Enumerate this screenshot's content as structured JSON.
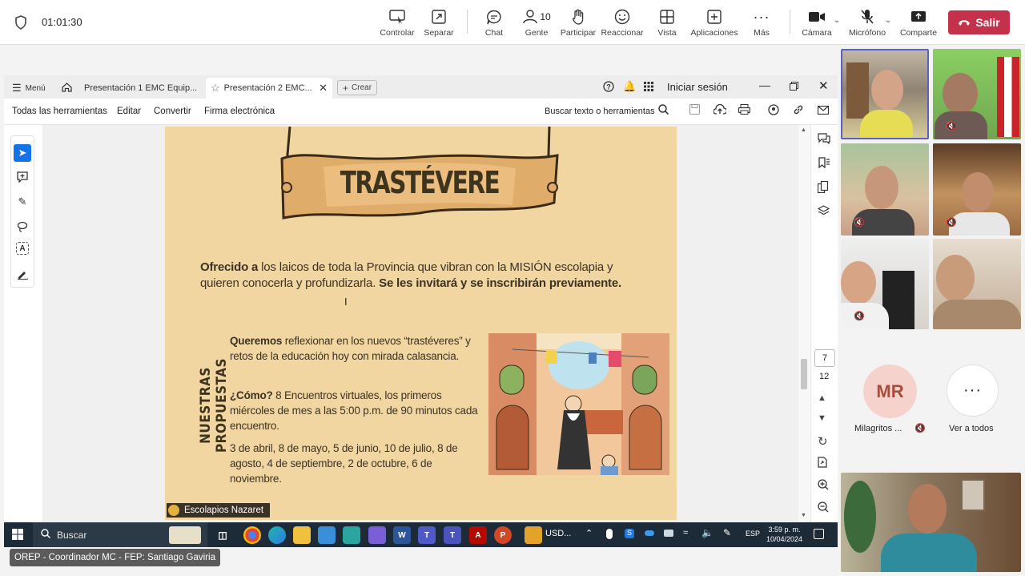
{
  "meeting": {
    "timer": "01:01:30",
    "controls": [
      {
        "label": "Controlar",
        "icon": "share-control-icon"
      },
      {
        "label": "Separar",
        "icon": "pop-out-icon"
      },
      {
        "label": "Chat",
        "icon": "chat-icon"
      },
      {
        "label": "Gente",
        "icon": "people-icon",
        "count": "10"
      },
      {
        "label": "Participar",
        "icon": "raise-hand-icon"
      },
      {
        "label": "Reaccionar",
        "icon": "emoji-icon"
      },
      {
        "label": "Vista",
        "icon": "grid-view-icon"
      },
      {
        "label": "Aplicaciones",
        "icon": "add-apps-icon"
      },
      {
        "label": "Más",
        "icon": "more-icon"
      },
      {
        "label": "Cámara",
        "icon": "camera-icon"
      },
      {
        "label": "Micrófono",
        "icon": "mic-off-icon"
      },
      {
        "label": "Comparte",
        "icon": "share-icon"
      }
    ],
    "leave_label": "Salir",
    "leave_color": "#c4314b"
  },
  "acrobat": {
    "menu_label": "Menú",
    "tabs": [
      "Presentación 1 EMC Equip...",
      "Presentación 2 EMC..."
    ],
    "new_tab_label": "Crear",
    "sign_in": "Iniciar sesión",
    "toolbar": [
      "Todas las herramientas",
      "Editar",
      "Convertir",
      "Firma electrónica"
    ],
    "search_label": "Buscar texto o herramientas",
    "page_current": "7",
    "page_total": "12"
  },
  "slide": {
    "banner_title": "TRASTÉVERE",
    "offer_bold": "Ofrecido a",
    "offer_text": "los laicos de toda la Provincia que vibran con la MISIÓN escolapia y quieren conocerla y profundizarla.",
    "offer_bold2": "Se les invitará y se inscribirán previamente.",
    "side_title": "NUESTRAS PROPUESTAS",
    "p1_bold": "Queremos",
    "p1_text": "reflexionar en los nuevos “trastéveres” y retos de la educación hoy con mirada calasancia.",
    "p2_bold": "¿Cómo?",
    "p2_text": "8 Encuentros virtuales, los primeros miércoles de mes a las 5:00 p.m. de 90 minutos cada encuentro.",
    "p3_text": "3 de abril, 8 de mayo, 5 de junio, 10 de julio, 8 de agosto, 4 de septiembre, 2 de octubre, 6 de noviembre.",
    "footer": "Escolapios Nazaret"
  },
  "taskbar": {
    "search_placeholder": "Buscar",
    "usd_label": "USD...",
    "language": "ESP",
    "time": "3:59 p. m.",
    "date": "10/04/2024"
  },
  "presenter_caption": "OREP - Coordinador MC - FEP: Santiago Gaviria",
  "participants": {
    "avatar_initials": "MR",
    "avatar_name": "Milagritos ...",
    "see_all": "Ver a todos"
  }
}
